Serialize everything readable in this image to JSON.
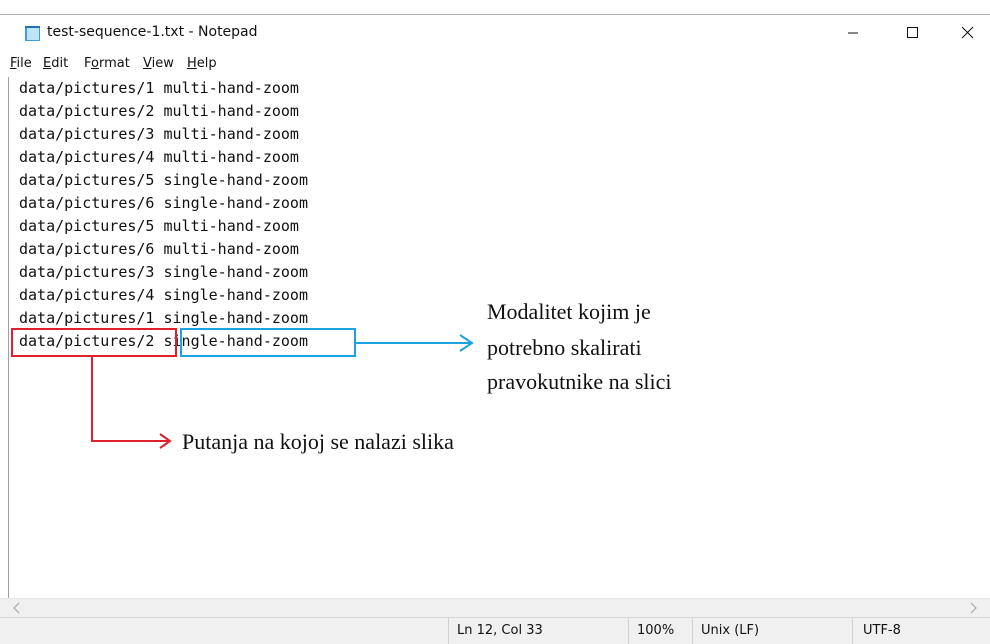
{
  "window": {
    "title": "test-sequence-1.txt - Notepad",
    "controls": {
      "minimize": "minimize",
      "maximize": "maximize",
      "close": "close"
    }
  },
  "menu": {
    "items": [
      {
        "pre": "",
        "acc": "F",
        "post": "ile"
      },
      {
        "pre": "",
        "acc": "E",
        "post": "dit"
      },
      {
        "pre": "F",
        "acc": "o",
        "post": "rmat"
      },
      {
        "pre": "",
        "acc": "V",
        "post": "iew"
      },
      {
        "pre": "",
        "acc": "H",
        "post": "elp"
      }
    ]
  },
  "editor": {
    "lines": [
      "data/pictures/1 multi-hand-zoom",
      "data/pictures/2 multi-hand-zoom",
      "data/pictures/3 multi-hand-zoom",
      "data/pictures/4 multi-hand-zoom",
      "data/pictures/5 single-hand-zoom",
      "data/pictures/6 single-hand-zoom",
      "data/pictures/5 multi-hand-zoom",
      "data/pictures/6 multi-hand-zoom",
      "data/pictures/3 single-hand-zoom",
      "data/pictures/4 single-hand-zoom",
      "data/pictures/1 single-hand-zoom",
      "data/pictures/2 single-hand-zoom"
    ]
  },
  "status": {
    "position": "Ln 12, Col 33",
    "zoom": "100%",
    "line_ending": "Unix (LF)",
    "encoding": "UTF-8"
  },
  "annotations": {
    "mode_note": [
      "Modalitet kojim je",
      "potrebno skalirati",
      "pravokutnike na slici"
    ],
    "path_note": "Putanja na kojoj se nalazi slika",
    "colors": {
      "path": "#e0202a",
      "mode": "#1aa3e0"
    }
  },
  "icons": {
    "app": "notepad-icon",
    "scroll_left": "chevron-left-icon",
    "scroll_right": "chevron-right-icon"
  }
}
